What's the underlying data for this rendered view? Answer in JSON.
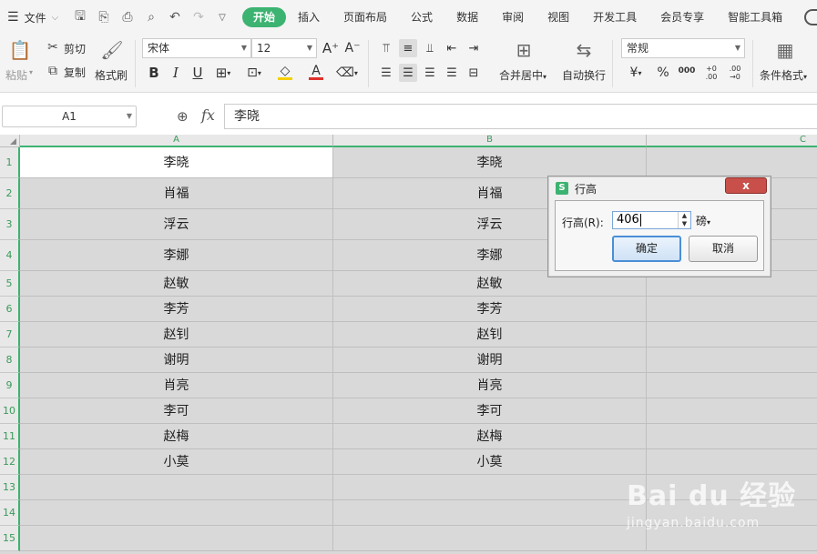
{
  "menubar": {
    "file_label": "文件",
    "tabs": [
      {
        "label": "开始",
        "active": true
      },
      {
        "label": "插入"
      },
      {
        "label": "页面布局"
      },
      {
        "label": "公式"
      },
      {
        "label": "数据"
      },
      {
        "label": "审阅"
      },
      {
        "label": "视图"
      },
      {
        "label": "开发工具"
      },
      {
        "label": "会员专享"
      },
      {
        "label": "智能工具箱"
      }
    ]
  },
  "ribbon": {
    "paste_label": "粘贴",
    "cut_label": "剪切",
    "copy_label": "复制",
    "format_painter_label": "格式刷",
    "font_name": "宋体",
    "font_size": "12",
    "bold": "B",
    "italic": "I",
    "underline": "U",
    "font_color_glyph": "A",
    "merge_label": "合并居中",
    "wrap_label": "自动换行",
    "number_format": "常规",
    "currency": "¥",
    "percent": "%",
    "thousands": "000",
    "inc_decimal": "+0 .00",
    "dec_decimal": ".00 →0",
    "cond_format_label": "条件格式",
    "accent_color": "#3cb371",
    "font_color": "#e0302a",
    "fill_color": "#f5d000"
  },
  "formula_bar": {
    "name_box": "A1",
    "fx": "fx",
    "content": "李晓"
  },
  "sheet": {
    "columns": [
      "A",
      "B",
      "C"
    ],
    "rows": [
      {
        "num": "1",
        "a": "李晓",
        "b": "李晓"
      },
      {
        "num": "2",
        "a": "肖福",
        "b": "肖福"
      },
      {
        "num": "3",
        "a": "浮云",
        "b": "浮云"
      },
      {
        "num": "4",
        "a": "李娜",
        "b": "李娜"
      },
      {
        "num": "5",
        "a": "赵敏",
        "b": "赵敏"
      },
      {
        "num": "6",
        "a": "李芳",
        "b": "李芳"
      },
      {
        "num": "7",
        "a": "赵钊",
        "b": "赵钊"
      },
      {
        "num": "8",
        "a": "谢明",
        "b": "谢明"
      },
      {
        "num": "9",
        "a": "肖亮",
        "b": "肖亮"
      },
      {
        "num": "10",
        "a": "李可",
        "b": "李可"
      },
      {
        "num": "11",
        "a": "赵梅",
        "b": "赵梅"
      },
      {
        "num": "12",
        "a": "小莫",
        "b": "小莫"
      },
      {
        "num": "13",
        "a": "",
        "b": ""
      },
      {
        "num": "14",
        "a": "",
        "b": ""
      },
      {
        "num": "15",
        "a": "",
        "b": ""
      }
    ]
  },
  "dialog": {
    "logo": "S",
    "title": "行高",
    "close_glyph": "x",
    "field_label": "行高(R):",
    "field_value": "406",
    "unit_label": "磅",
    "ok_label": "确定",
    "cancel_label": "取消"
  },
  "watermark": {
    "brand": "Bai du 经验",
    "url": "jingyan.baidu.com"
  }
}
